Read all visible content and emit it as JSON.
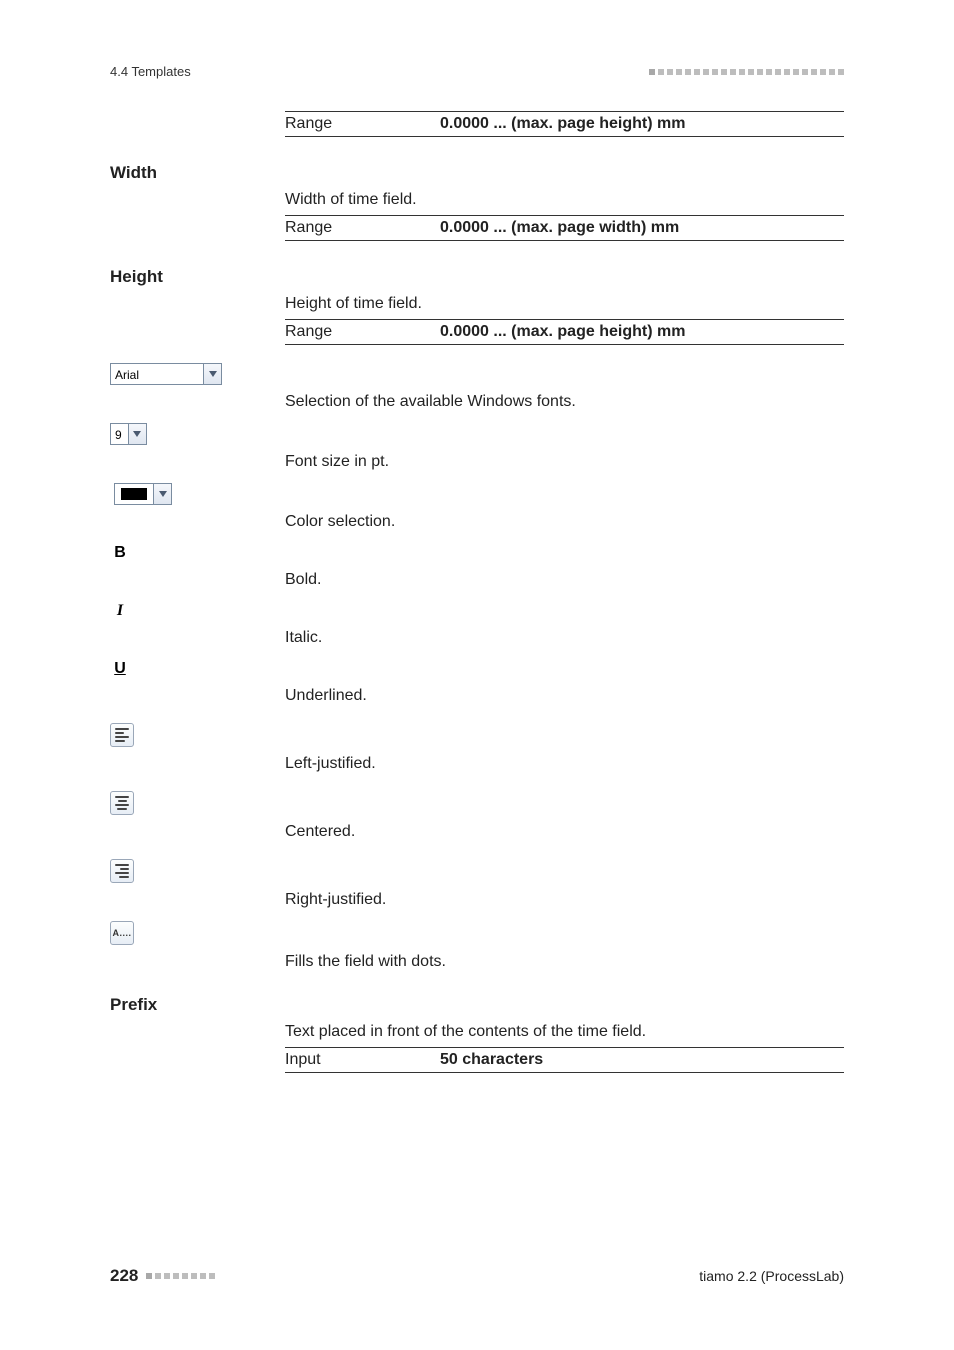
{
  "header": {
    "section": "4.4 Templates"
  },
  "rows": {
    "range_top": {
      "label": "Range",
      "value": "0.0000 ... (max. page height) mm"
    },
    "width": {
      "title": "Width",
      "desc": "Width of time field.",
      "range_label": "Range",
      "range_value": "0.0000 ... (max. page width) mm"
    },
    "height": {
      "title": "Height",
      "desc": "Height of time field.",
      "range_label": "Range",
      "range_value": "0.0000 ... (max. page height) mm"
    },
    "font": {
      "value": "Arial",
      "desc": "Selection of the available Windows fonts."
    },
    "size": {
      "value": "9",
      "desc": "Font size in pt."
    },
    "color": {
      "desc": "Color selection."
    },
    "bold": {
      "desc": "Bold."
    },
    "italic": {
      "desc": "Italic."
    },
    "underline": {
      "desc": "Underlined."
    },
    "align_left": {
      "desc": "Left-justified."
    },
    "align_center": {
      "desc": "Centered."
    },
    "align_right": {
      "desc": "Right-justified."
    },
    "dots": {
      "glyph": "A....",
      "desc": "Fills the field with dots."
    },
    "prefix": {
      "title": "Prefix",
      "desc": "Text placed in front of the contents of the time field.",
      "input_label": "Input",
      "input_value": "50 characters"
    }
  },
  "footer": {
    "page": "228",
    "product": "tiamo 2.2 (ProcessLab)"
  }
}
